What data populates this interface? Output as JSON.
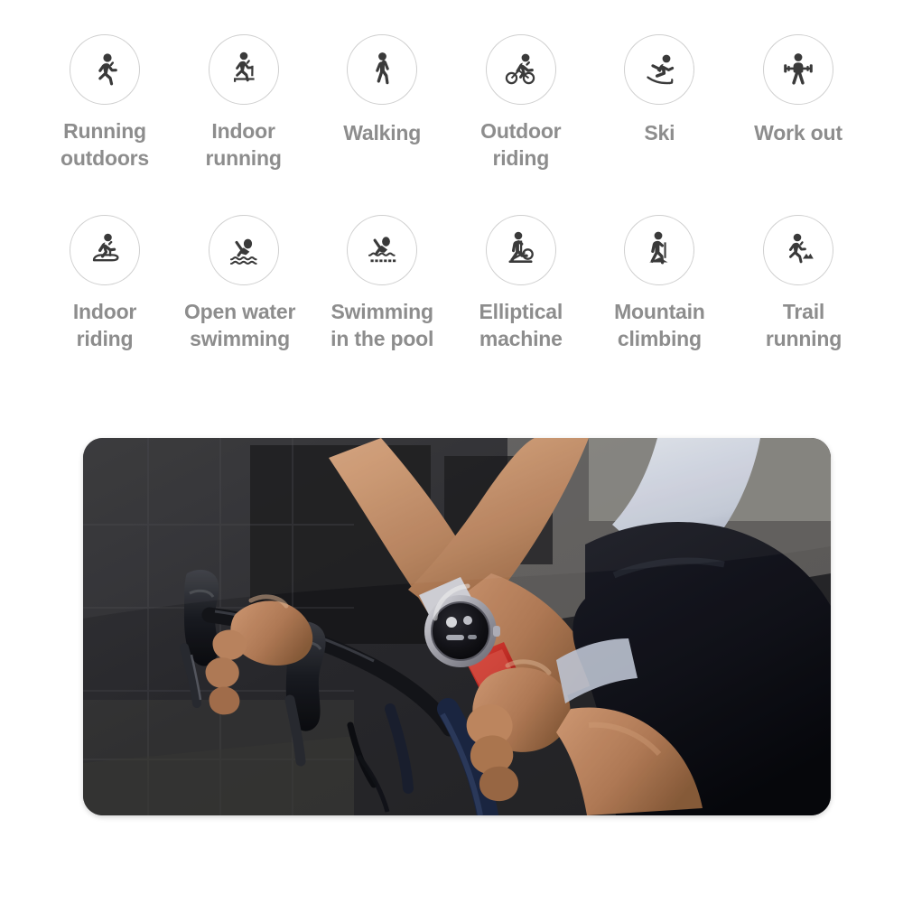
{
  "page": {
    "background_color": "#ffffff",
    "label_color": "#8d8d8d",
    "circle_border_color": "#cfcfcf"
  },
  "sport_modes": {
    "rows": [
      [
        {
          "icon": "running-outdoors-icon",
          "label": "Running\noutdoors"
        },
        {
          "icon": "indoor-running-icon",
          "label": "Indoor\nrunning"
        },
        {
          "icon": "walking-icon",
          "label": "Walking"
        },
        {
          "icon": "outdoor-riding-icon",
          "label": "Outdoor\nriding"
        },
        {
          "icon": "ski-icon",
          "label": "Ski"
        },
        {
          "icon": "work-out-icon",
          "label": "Work out"
        }
      ],
      [
        {
          "icon": "indoor-riding-icon",
          "label": "Indoor\nriding"
        },
        {
          "icon": "open-water-swimming-icon",
          "label": "Open water\nswimming"
        },
        {
          "icon": "swimming-in-the-pool-icon",
          "label": "Swimming\nin the pool"
        },
        {
          "icon": "elliptical-machine-icon",
          "label": "Elliptical\nmachine"
        },
        {
          "icon": "mountain-climbing-icon",
          "label": "Mountain\nclimbing"
        },
        {
          "icon": "trail-running-icon",
          "label": "Trail\nrunning"
        }
      ]
    ]
  },
  "photo": {
    "description": "Cyclist hands gripping drop handlebars wearing a round smartwatch with red strap",
    "watch_dial_color": "#111114",
    "watch_bezel_color": "#c9c9cf",
    "watch_strap_color": "#d2312b",
    "shorts_color": "#12131a",
    "jersey_color": "#d8dce6",
    "skin_color": "#c08a63",
    "background_color": "#2a2a2d",
    "corner_radius": "22px"
  }
}
